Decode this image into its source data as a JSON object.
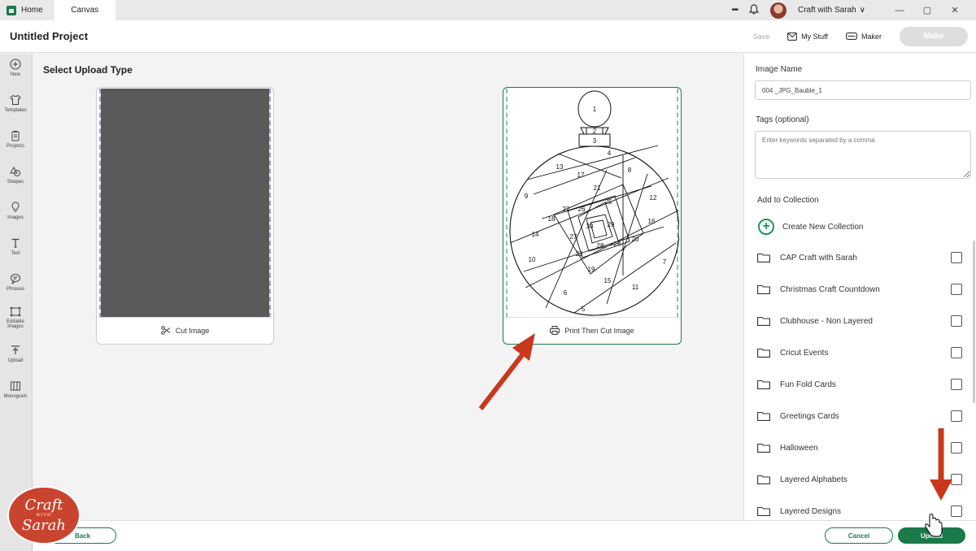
{
  "titlebar": {
    "home_tab": "Home",
    "canvas_tab": "Canvas",
    "more_glyph": "•••",
    "account_name": "Craft with Sarah",
    "chevron": "∨",
    "min_glyph": "—",
    "max_glyph": "▢",
    "close_glyph": "✕"
  },
  "header": {
    "project_title": "Untitled Project",
    "save_label": "Save",
    "mystuff_label": "My Stuff",
    "maker_label": "Maker",
    "make_label": "Make"
  },
  "sidebar": {
    "items": [
      {
        "label": "New",
        "icon": "plus-circle-icon"
      },
      {
        "label": "Templates",
        "icon": "shirt-icon"
      },
      {
        "label": "Projects",
        "icon": "projects-icon"
      },
      {
        "label": "Shapes",
        "icon": "shapes-icon"
      },
      {
        "label": "Images",
        "icon": "bulb-icon"
      },
      {
        "label": "Text",
        "icon": "text-icon"
      },
      {
        "label": "Phrases",
        "icon": "speech-icon"
      },
      {
        "label": "Editable",
        "label2": "Images",
        "icon": "editable-icon"
      },
      {
        "label": "Upload",
        "icon": "upload-icon"
      },
      {
        "label": "Monogram",
        "icon": "monogram-icon"
      }
    ]
  },
  "main": {
    "title": "Select Upload Type",
    "cut_card_label": "Cut Image",
    "print_card_label": "Print Then Cut Image",
    "ornament_numbers": [
      "1",
      "2",
      "3",
      "4",
      "5",
      "6",
      "7",
      "8",
      "9",
      "10",
      "11",
      "12",
      "13",
      "14",
      "15",
      "16",
      "17",
      "18",
      "19",
      "20",
      "21",
      "22",
      "23",
      "24",
      "25",
      "26",
      "27",
      "28",
      "29",
      "30"
    ]
  },
  "right_panel": {
    "image_name_label": "Image Name",
    "image_name_value": "004 _JPG_Bauble_1",
    "tags_label": "Tags (optional)",
    "tags_placeholder": "Enter keywords separated by a comma",
    "add_collection_label": "Add to Collection",
    "create_collection_label": "Create New Collection",
    "collections": [
      "CAP Craft with Sarah",
      "Christmas Craft Countdown",
      "Clubhouse - Non Layered",
      "Cricut Events",
      "Fun Fold Cards",
      "Greetings Cards",
      "Halloween",
      "Layered Alphabets",
      "Layered Designs"
    ]
  },
  "bottom": {
    "back_label": "Back",
    "cancel_label": "Cancel",
    "upload_label": "Upload"
  },
  "watermark": {
    "line1": "Craft",
    "line2": "WITH",
    "line3": "Sarah"
  },
  "colors": {
    "brand_green": "#1a7a4a",
    "annotation_red": "#c8381e"
  }
}
